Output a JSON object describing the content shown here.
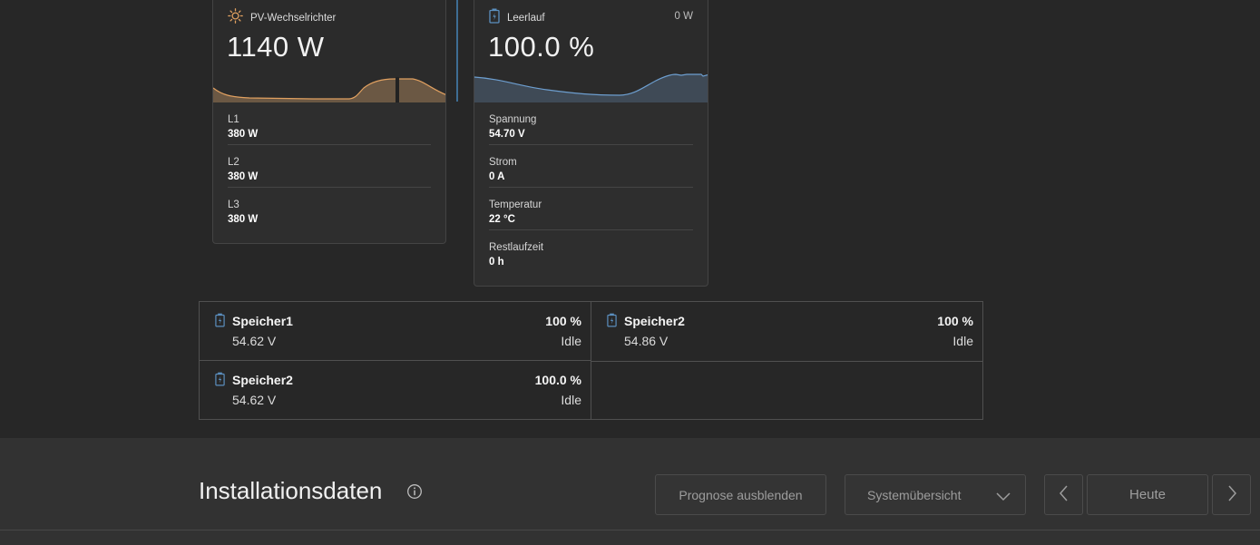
{
  "pv_card": {
    "title": "PV-Wechselrichter",
    "value": "1140 W",
    "rows": [
      {
        "label": "L1",
        "value": "380 W"
      },
      {
        "label": "L2",
        "value": "380 W"
      },
      {
        "label": "L3",
        "value": "380 W"
      }
    ],
    "accent": "#e0a060"
  },
  "battery_card": {
    "title": "Leerlauf",
    "power": "0 W",
    "value": "100.0 %",
    "rows": [
      {
        "label": "Spannung",
        "value": "54.70 V"
      },
      {
        "label": "Strom",
        "value": "0 A"
      },
      {
        "label": "Temperatur",
        "value": "22 °C"
      },
      {
        "label": "Restlaufzeit",
        "value": "0 h"
      }
    ],
    "accent": "#5b8fbf"
  },
  "batteries": [
    {
      "name": "Speicher1",
      "voltage": "54.62 V",
      "percent": "100 %",
      "state": "Idle"
    },
    {
      "name": "Speicher2",
      "voltage": "54.86 V",
      "percent": "100 %",
      "state": "Idle"
    },
    {
      "name": "Speicher2",
      "voltage": "54.62 V",
      "percent": "100.0 %",
      "state": "Idle"
    }
  ],
  "installation": {
    "title": "Installationsdaten",
    "hide_forecast_label": "Prognose ausblenden",
    "view_select_value": "Systemübersicht",
    "date_label": "Heute"
  },
  "icons": {
    "pv": "sun-icon",
    "battery": "battery-icon",
    "info": "info-icon",
    "dropdown": "chevron-down-icon",
    "prev": "chevron-left-icon",
    "next": "chevron-right-icon"
  }
}
